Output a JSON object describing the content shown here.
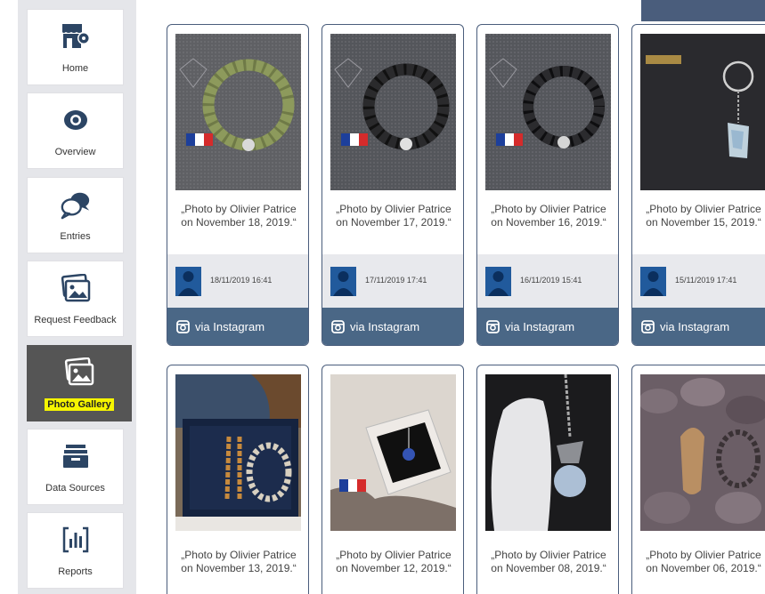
{
  "sidebar": {
    "items": [
      {
        "label": "Home",
        "icon": "home-store-icon"
      },
      {
        "label": "Overview",
        "icon": "eye-icon"
      },
      {
        "label": "Entries",
        "icon": "chat-bubbles-icon"
      },
      {
        "label": "Request Feedback",
        "icon": "image-frame-icon"
      },
      {
        "label": "Photo Gallery",
        "icon": "photo-gallery-icon",
        "active": true
      },
      {
        "label": "Data Sources",
        "icon": "inbox-tray-icon"
      },
      {
        "label": "Reports",
        "icon": "bar-chart-icon"
      }
    ]
  },
  "gallery": {
    "cards": [
      {
        "caption_line1": "„Photo by Olivier Patrice",
        "caption_line2": "on November 18, 2019.“",
        "date": "18/11/2019 16:41",
        "via": "via Instagram"
      },
      {
        "caption_line1": "„Photo by Olivier Patrice",
        "caption_line2": "on November 17, 2019.“",
        "date": "17/11/2019 17:41",
        "via": "via Instagram"
      },
      {
        "caption_line1": "„Photo by Olivier Patrice",
        "caption_line2": "on November 16, 2019.“",
        "date": "16/11/2019 15:41",
        "via": "via Instagram"
      },
      {
        "caption_line1": "„Photo by Olivier Patrice",
        "caption_line2": "on November 15, 2019.“",
        "date": "15/11/2019 17:41",
        "via": "via Instagram"
      },
      {
        "caption_line1": "„Photo by Olivier Patrice",
        "caption_line2": "on November 13, 2019.“"
      },
      {
        "caption_line1": "„Photo by Olivier Patrice",
        "caption_line2": "on November 12, 2019.“"
      },
      {
        "caption_line1": "„Photo by Olivier Patrice",
        "caption_line2": "on November 08, 2019.“"
      },
      {
        "caption_line1": "„Photo by Olivier Patrice",
        "caption_line2": "on November 06, 2019.“"
      }
    ]
  },
  "colors": {
    "accent": "#4a6786",
    "card_border": "#4a5d7c",
    "highlight": "#f6f500",
    "active_nav": "#555555",
    "avatar": "#215a9c"
  }
}
